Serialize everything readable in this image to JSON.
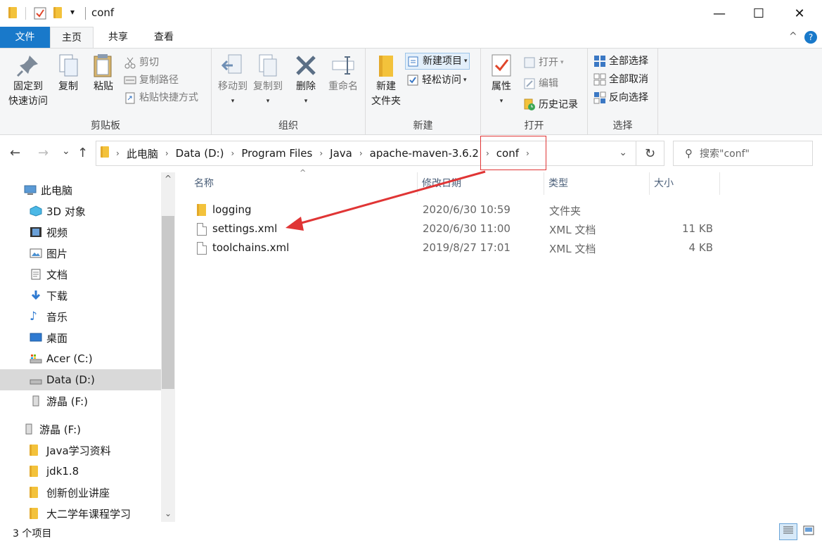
{
  "window": {
    "title": "conf",
    "minimize": "—",
    "maximize": "☐",
    "close": "✕",
    "qa_dropdown": "▾"
  },
  "ribbon": {
    "tabs": [
      "文件",
      "主页",
      "共享",
      "查看"
    ],
    "collapse": "^",
    "help": "?",
    "clipboard": {
      "label": "剪贴板",
      "pin_line1": "固定到",
      "pin_line2": "快速访问",
      "copy": "复制",
      "paste": "粘贴",
      "cut": "剪切",
      "copy_path": "复制路径",
      "paste_shortcut": "粘贴快捷方式"
    },
    "organize": {
      "label": "组织",
      "move_to": "移动到",
      "copy_to": "复制到",
      "delete": "删除",
      "rename": "重命名"
    },
    "new": {
      "label": "新建",
      "new_folder_line1": "新建",
      "new_folder_line2": "文件夹",
      "new_item": "新建项目",
      "easy_access": "轻松访问"
    },
    "open": {
      "label": "打开",
      "properties": "属性",
      "open": "打开",
      "edit": "编辑",
      "history": "历史记录"
    },
    "select": {
      "label": "选择",
      "select_all": "全部选择",
      "select_none": "全部取消",
      "invert": "反向选择"
    }
  },
  "address": {
    "back": "←",
    "forward": "→",
    "recent": "⌄",
    "up": "↑",
    "crumbs": [
      "此电脑",
      "Data (D:)",
      "Program Files",
      "Java",
      "apache-maven-3.6.2",
      "conf"
    ],
    "dropdown": "⌄",
    "refresh": "↻",
    "search_placeholder": "搜索\"conf\""
  },
  "nav_pane": {
    "items": [
      {
        "label": "此电脑",
        "icon": "computer-icon"
      },
      {
        "label": "3D 对象",
        "icon": "3d-objects-icon"
      },
      {
        "label": "视频",
        "icon": "video-icon"
      },
      {
        "label": "图片",
        "icon": "pictures-icon"
      },
      {
        "label": "文档",
        "icon": "documents-icon"
      },
      {
        "label": "下载",
        "icon": "download-icon"
      },
      {
        "label": "音乐",
        "icon": "music-icon"
      },
      {
        "label": "桌面",
        "icon": "desktop-icon"
      },
      {
        "label": "Acer (C:)",
        "icon": "drive-c-icon"
      },
      {
        "label": "Data (D:)",
        "icon": "drive-d-icon",
        "selected": true
      },
      {
        "label": "游晶 (F:)",
        "icon": "usb-drive-icon"
      },
      {
        "label": "游晶 (F:)",
        "icon": "usb-drive-icon"
      },
      {
        "label": "Java学习资料",
        "icon": "folder-icon"
      },
      {
        "label": "jdk1.8",
        "icon": "folder-icon"
      },
      {
        "label": "创新创业讲座",
        "icon": "folder-icon"
      },
      {
        "label": "大二学年课程学习",
        "icon": "folder-icon"
      }
    ],
    "scroll_up": "^",
    "scroll_down": "⌄"
  },
  "file_list": {
    "columns": {
      "name": "名称",
      "modified": "修改日期",
      "type": "类型",
      "size": "大小"
    },
    "sort_caret": "^",
    "files": [
      {
        "name": "logging",
        "modified": "2020/6/30 10:59",
        "type": "文件夹",
        "size": "",
        "icon": "folder-icon"
      },
      {
        "name": "settings.xml",
        "modified": "2020/6/30 11:00",
        "type": "XML 文档",
        "size": "11 KB",
        "icon": "xml-file-icon"
      },
      {
        "name": "toolchains.xml",
        "modified": "2019/8/27 17:01",
        "type": "XML 文档",
        "size": "4 KB",
        "icon": "xml-file-icon"
      }
    ]
  },
  "status": {
    "item_count": "3 个项目"
  },
  "colors": {
    "file_tab": "#1979ca",
    "annotation": "#e03535",
    "folder": "#f3c23b"
  }
}
